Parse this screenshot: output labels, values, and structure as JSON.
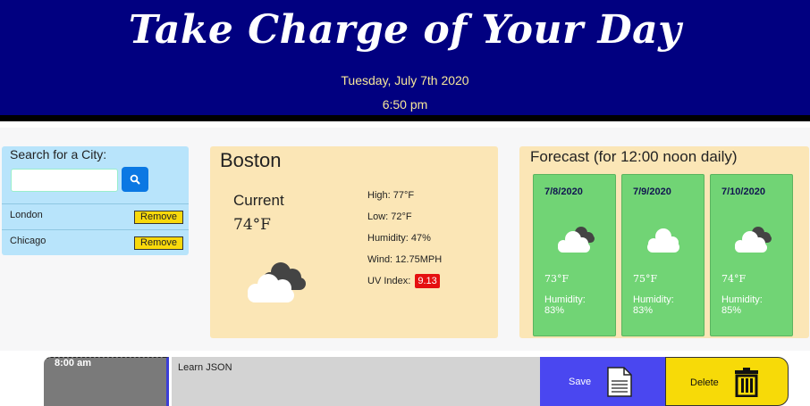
{
  "header": {
    "title": "Take Charge of Your Day",
    "date": "Tuesday, July 7th 2020",
    "time": "6:50 pm"
  },
  "search": {
    "label": "Search for a City:",
    "input_value": "",
    "placeholder": "",
    "button_icon": "search-icon",
    "cities": [
      {
        "name": "London",
        "remove_label": "Remove"
      },
      {
        "name": "Chicago",
        "remove_label": "Remove"
      }
    ]
  },
  "current": {
    "city": "Boston",
    "label": "Current",
    "temp": "74°F",
    "high": "High: 77°F",
    "low": "Low: 72°F",
    "humidity": "Humidity: 47%",
    "wind": "Wind: 12.75MPH",
    "uv_label": "UV Index:",
    "uv_value": "9.13",
    "icon": "partly-cloudy-icon"
  },
  "forecast": {
    "title": "Forecast (for 12:00 noon daily)",
    "days": [
      {
        "date": "7/8/2020",
        "icon": "cloudy-icon",
        "temp": "73°F",
        "humidity_label": "Humidity:",
        "humidity": "83%"
      },
      {
        "date": "7/9/2020",
        "icon": "cloud-icon",
        "temp": "75°F",
        "humidity_label": "Humidity:",
        "humidity": "83%"
      },
      {
        "date": "7/10/2020",
        "icon": "cloudy-icon",
        "temp": "74°F",
        "humidity_label": "Humidity:",
        "humidity": "85%"
      }
    ]
  },
  "planner": {
    "rows": [
      {
        "hour": "8:00 am",
        "task": "Learn JSON",
        "save_label": "Save",
        "delete_label": "Delete"
      }
    ]
  },
  "colors": {
    "header_bg": "#010080",
    "search_bg": "#b8e4fb",
    "panel_bg": "#fbe6b6",
    "forecast_card": "#71d475",
    "uv_badge": "#e51010",
    "save_bg": "#4a47f0",
    "delete_bg": "#f7da08"
  }
}
